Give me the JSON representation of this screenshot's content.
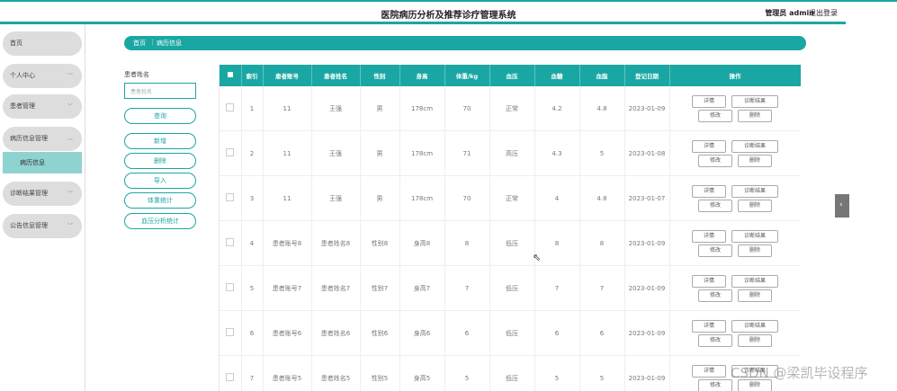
{
  "header": {
    "title": "医院病历分析及推荐诊疗管理系统",
    "admin": "管理员 admin",
    "logout": "退出登录"
  },
  "sidebar": {
    "items": [
      {
        "label": "首页"
      },
      {
        "label": "个人中心"
      },
      {
        "label": "患者管理"
      },
      {
        "label": "病历信息管理"
      },
      {
        "label": "病历信息"
      },
      {
        "label": "诊断结果管理"
      },
      {
        "label": "公告信息管理"
      }
    ]
  },
  "breadcrumb": {
    "home": "首页",
    "sep": "⋮",
    "current": "病历信息"
  },
  "search": {
    "label": "患者姓名",
    "placeholder": "患者姓名"
  },
  "buttons": {
    "query": "查询",
    "add": "新增",
    "delete": "删除",
    "import": "导入",
    "weight_stats": "体重统计",
    "bp_stats": "血压分析统计"
  },
  "table": {
    "headers": [
      "索引",
      "患者账号",
      "患者姓名",
      "性别",
      "身高",
      "体重/kg",
      "血压",
      "血糖",
      "血脂",
      "登记日期",
      "操作"
    ],
    "ops": {
      "detail": "详情",
      "diagnosis": "诊断结果",
      "edit": "修改",
      "remove": "删除"
    },
    "rows": [
      [
        "1",
        "11",
        "王强",
        "男",
        "178cm",
        "70",
        "正常",
        "4.2",
        "4.8",
        "2023-01-09"
      ],
      [
        "2",
        "11",
        "王强",
        "男",
        "178cm",
        "71",
        "高压",
        "4.3",
        "5",
        "2023-01-08"
      ],
      [
        "3",
        "11",
        "王强",
        "男",
        "178cm",
        "70",
        "正常",
        "4",
        "4.8",
        "2023-01-07"
      ],
      [
        "4",
        "患者账号8",
        "患者姓名8",
        "性别8",
        "身高8",
        "8",
        "低压",
        "8",
        "8",
        "2023-01-09"
      ],
      [
        "5",
        "患者账号7",
        "患者姓名7",
        "性别7",
        "身高7",
        "7",
        "低压",
        "7",
        "7",
        "2023-01-09"
      ],
      [
        "6",
        "患者账号6",
        "患者姓名6",
        "性别6",
        "身高6",
        "6",
        "低压",
        "6",
        "6",
        "2023-01-09"
      ],
      [
        "7",
        "患者账号5",
        "患者姓名5",
        "性别5",
        "身高5",
        "5",
        "低压",
        "5",
        "5",
        "2023-01-09"
      ]
    ]
  },
  "watermark": "CSDN @梁凯毕设程序"
}
